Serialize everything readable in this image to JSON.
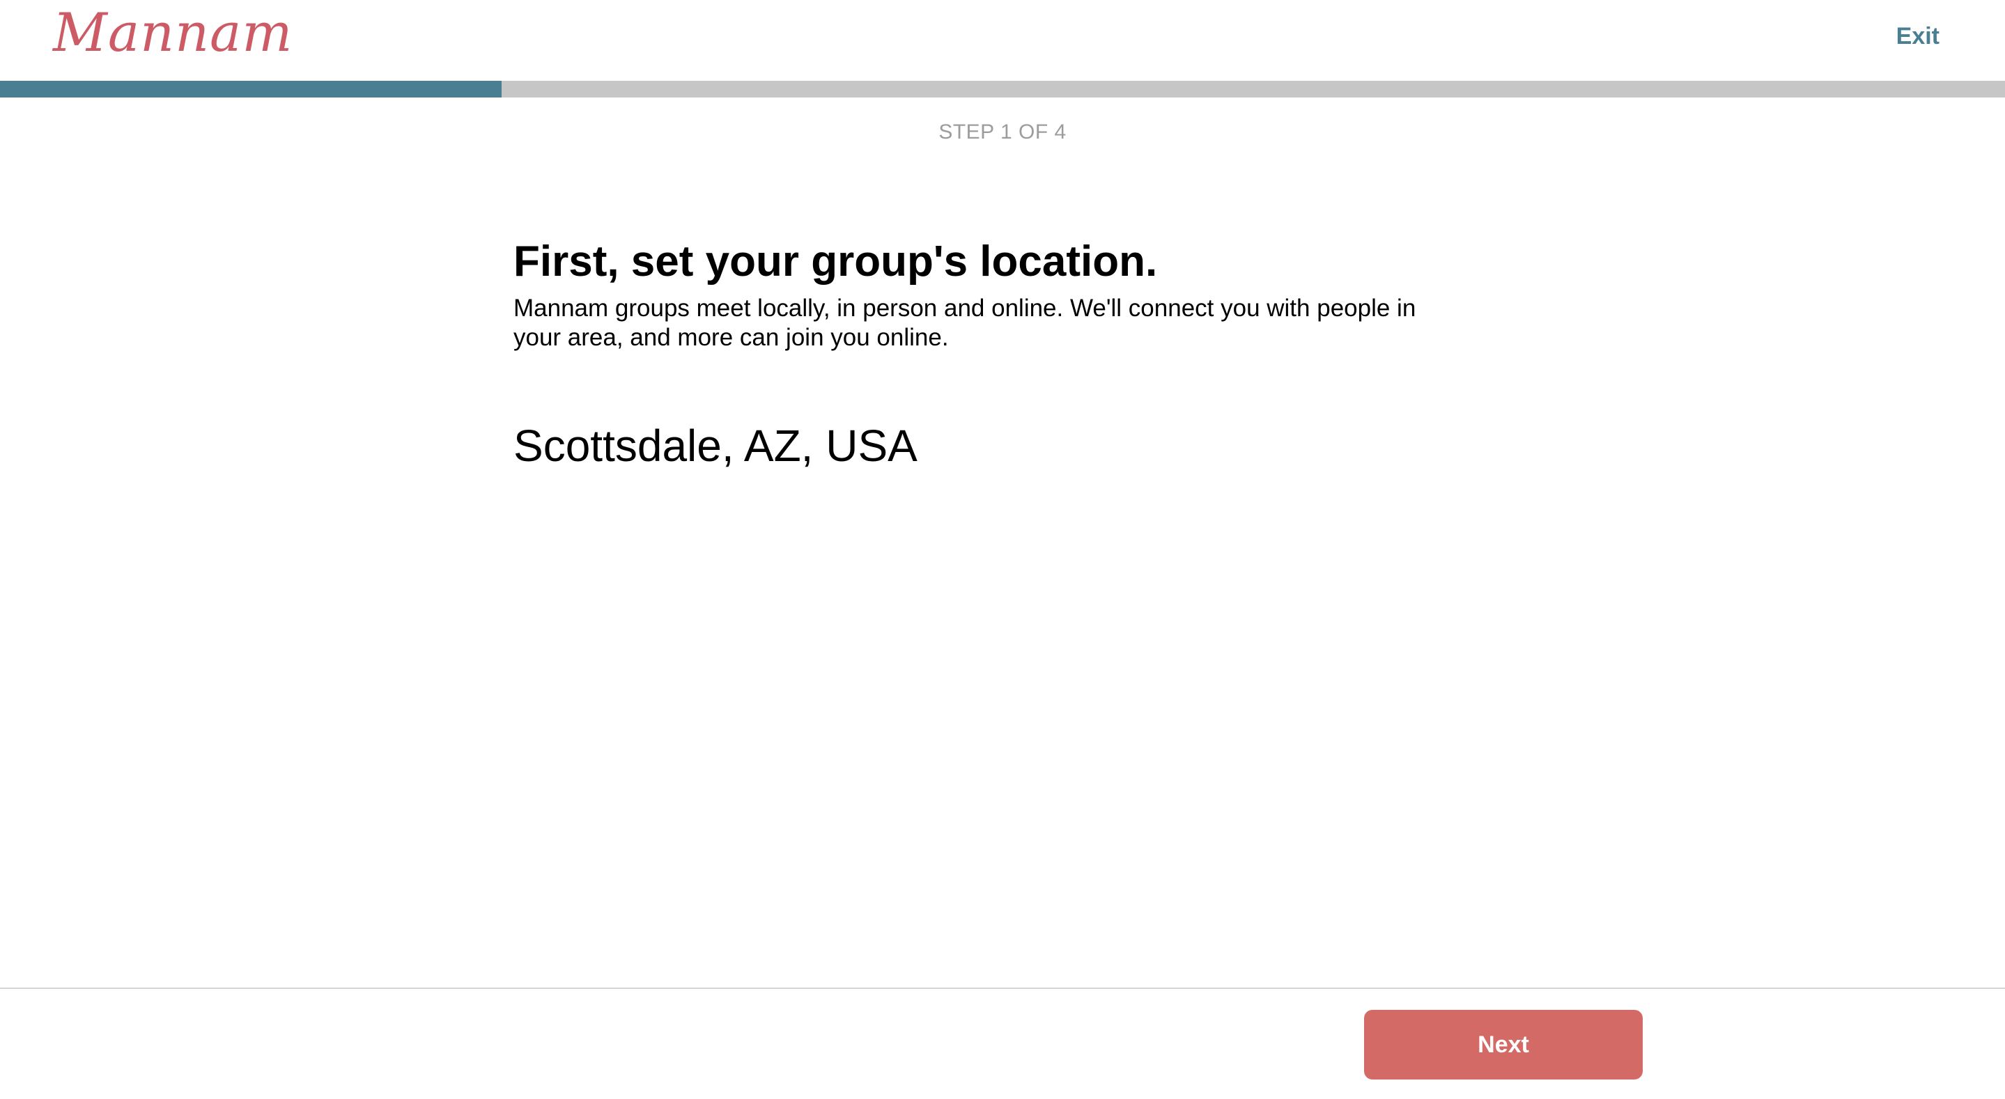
{
  "header": {
    "logo_text": "Mannam",
    "exit_label": "Exit"
  },
  "progress": {
    "step_label": "STEP 1 OF 4",
    "current_step": 1,
    "total_steps": 4,
    "fill_fraction": 0.25
  },
  "main": {
    "heading": "First, set your group's location.",
    "description": "Mannam groups meet locally, in person and online. We'll connect you with people in your area, and more can join you online.",
    "location_value": "Scottsdale, AZ, USA"
  },
  "footer": {
    "next_label": "Next"
  },
  "colors": {
    "brand": "#cc5b66",
    "accent": "#4a7f93",
    "progress_track": "#c6c6c6",
    "next_button": "#d46a66"
  }
}
